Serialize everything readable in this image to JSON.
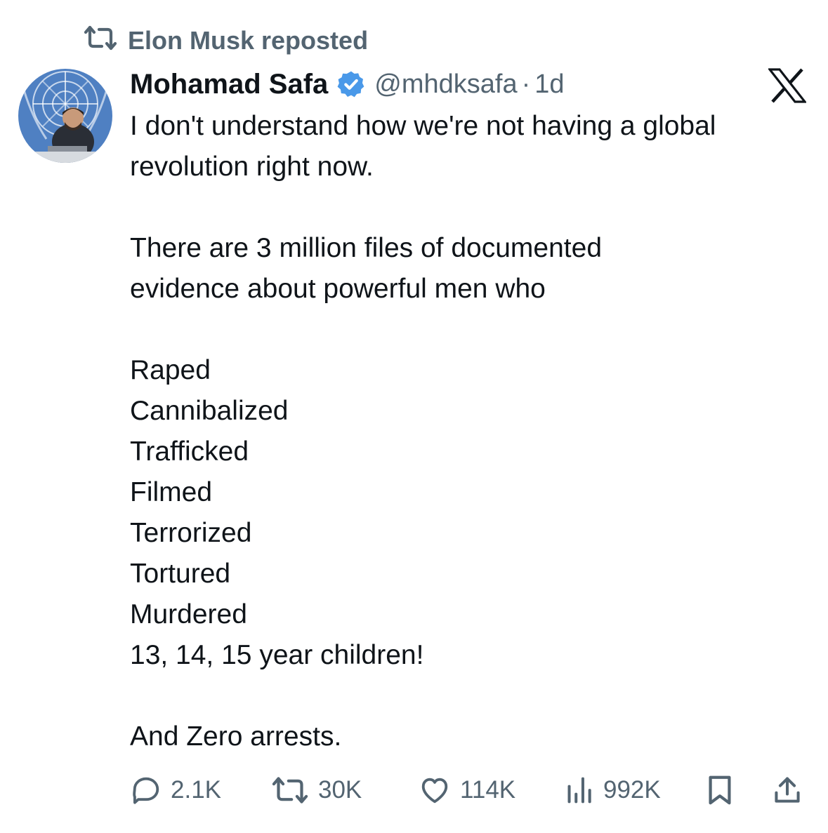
{
  "social_context": {
    "text": "Elon Musk reposted",
    "icon": "repost-icon"
  },
  "author": {
    "name": "Mohamad Safa",
    "handle": "@mhdksafa",
    "separator": "·",
    "time": "1d",
    "verified": true,
    "verified_color": "#4a99e9",
    "avatar_icon": "profile-photo"
  },
  "platform_logo": "x-logo-icon",
  "tweet": {
    "lines": [
      "I don't understand how we're not having a global",
      "revolution right now.",
      "",
      "There are 3 million files of documented",
      "evidence about powerful men who",
      "",
      "Raped",
      "Cannibalized",
      "Trafficked",
      "Filmed",
      "Terrorized",
      "Tortured",
      "Murdered",
      "13, 14, 15 year children!",
      "",
      "And Zero arrests."
    ]
  },
  "actions": {
    "replies": "2.1K",
    "reposts": "30K",
    "likes": "114K",
    "views": "992K",
    "icons": [
      "reply-icon",
      "repost-icon",
      "like-icon",
      "views-icon",
      "bookmark-icon",
      "share-icon"
    ]
  },
  "colors": {
    "text": "#0f1419",
    "secondary": "#536471",
    "background": "#ffffff",
    "verified": "#4a99e9"
  }
}
